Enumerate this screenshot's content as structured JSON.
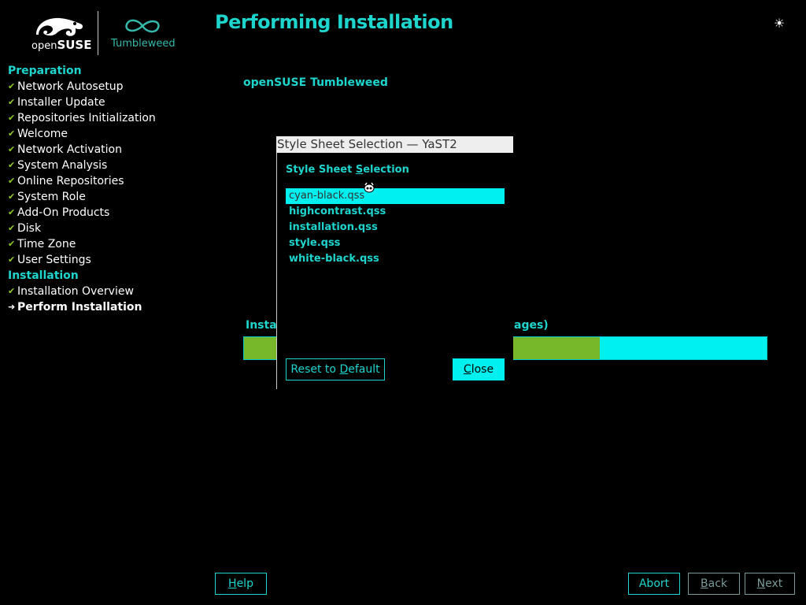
{
  "header": {
    "brand_light": "open",
    "brand_bold": "SUSE",
    "tumbleweed": "Tumbleweed",
    "title": "Performing Installation",
    "theme_icon": "sun-icon"
  },
  "sidebar": {
    "sections": [
      {
        "label": "Preparation",
        "items": [
          {
            "label": "Network Autosetup",
            "state": "done"
          },
          {
            "label": "Installer Update",
            "state": "done"
          },
          {
            "label": "Repositories Initialization",
            "state": "done"
          },
          {
            "label": "Welcome",
            "state": "done"
          },
          {
            "label": "Network Activation",
            "state": "done"
          },
          {
            "label": "System Analysis",
            "state": "done"
          },
          {
            "label": "Online Repositories",
            "state": "done"
          },
          {
            "label": "System Role",
            "state": "done"
          },
          {
            "label": "Add-On Products",
            "state": "done"
          },
          {
            "label": "Disk",
            "state": "done"
          },
          {
            "label": "Time Zone",
            "state": "done"
          },
          {
            "label": "User Settings",
            "state": "done"
          }
        ]
      },
      {
        "label": "Installation",
        "items": [
          {
            "label": "Installation Overview",
            "state": "done"
          },
          {
            "label": "Perform Installation",
            "state": "current"
          }
        ]
      }
    ]
  },
  "main": {
    "product": "openSUSE Tumbleweed",
    "progress_label_left": "Install",
    "progress_label_right": "ages)",
    "progress_fraction": 0.68
  },
  "dialog": {
    "window_title": "Style Sheet Selection — YaST2",
    "heading_pre": "Style Sheet ",
    "heading_ul": "S",
    "heading_post": "election",
    "items": [
      "cyan-black.qss",
      "highcontrast.qss",
      "installation.qss",
      "style.qss",
      "white-black.qss"
    ],
    "selected_index": 0,
    "reset_pre": "Reset to ",
    "reset_ul": "D",
    "reset_post": "efault",
    "close_ul": "C",
    "close_post": "lose"
  },
  "footer": {
    "help_ul": "H",
    "help_post": "elp",
    "abort_label": "Abort",
    "back_ul": "B",
    "back_post": "ack",
    "next_ul": "N",
    "next_post": "ext"
  },
  "colors": {
    "accent": "#1ed5ce",
    "cyan": "#00f0f0",
    "green": "#76b82a",
    "check": "#8fcb2a"
  }
}
